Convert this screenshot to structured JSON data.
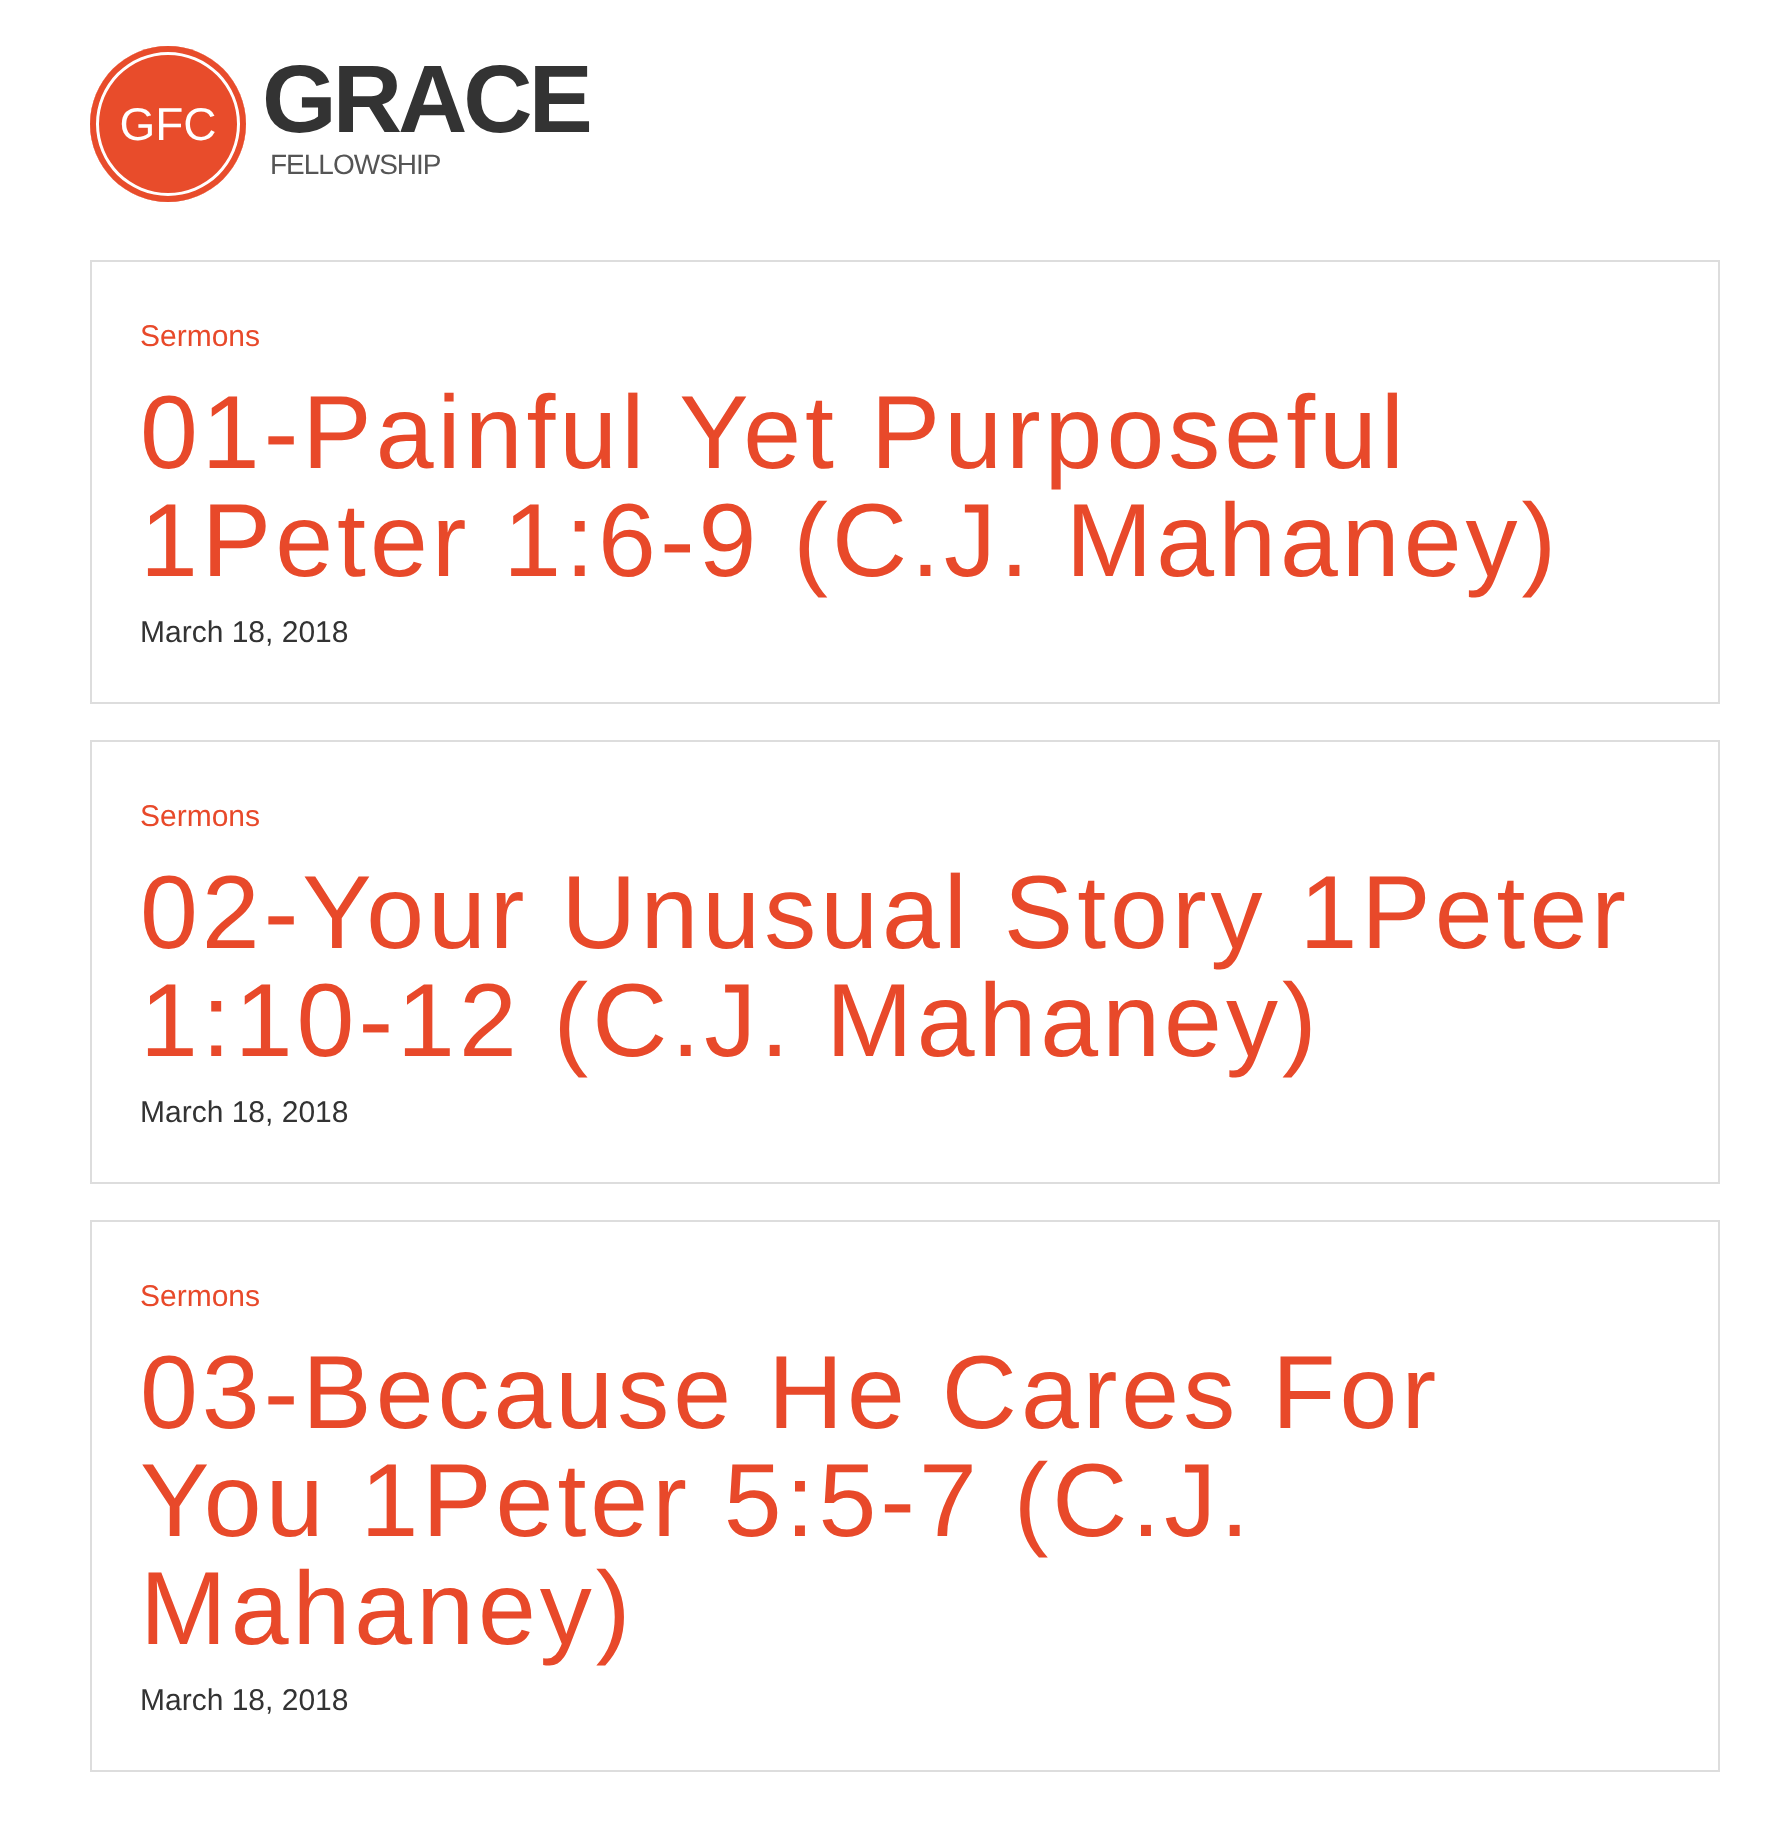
{
  "header": {
    "logo": {
      "badge": "GFC",
      "name": "GRACE",
      "tagline": "FELLOWSHIP"
    }
  },
  "posts": [
    {
      "category": "Sermons",
      "title": "01-Painful Yet Purposeful 1Peter 1:6-9 (C.J. Mahaney)",
      "date": "March 18, 2018"
    },
    {
      "category": "Sermons",
      "title": "02-Your Unusual Story 1Peter 1:10-12 (C.J. Mahaney)",
      "date": "March 18, 2018"
    },
    {
      "category": "Sermons",
      "title": "03-Because He Cares For You 1Peter 5:5-7 (C.J. Mahaney)",
      "date": "March 18, 2018"
    }
  ]
}
